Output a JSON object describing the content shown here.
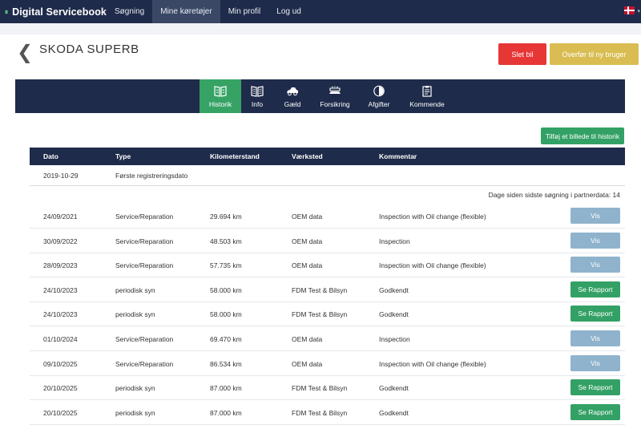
{
  "brand": {
    "name": "Digital Servicebook"
  },
  "nav": {
    "items": [
      {
        "label": "Søgning",
        "active": false
      },
      {
        "label": "Mine køretøjer",
        "active": true
      },
      {
        "label": "Min profil",
        "active": false
      },
      {
        "label": "Log ud",
        "active": false
      }
    ],
    "language_flag": "danish-flag-icon"
  },
  "vehicle": {
    "title": "SKODA SUPERB"
  },
  "actions": {
    "delete_label": "Slet bil",
    "transfer_label": "Overfør til ny bruger"
  },
  "tabs": [
    {
      "label": "Historik",
      "icon": "book-icon",
      "active": true
    },
    {
      "label": "Info",
      "icon": "open-book-icon",
      "active": false
    },
    {
      "label": "Gæld",
      "icon": "car-icon",
      "active": false
    },
    {
      "label": "Forsikring",
      "icon": "car-crash-icon",
      "active": false
    },
    {
      "label": "Afgifter",
      "icon": "coin-icon",
      "active": false
    },
    {
      "label": "Kommende",
      "icon": "clipboard-icon",
      "active": false
    }
  ],
  "history": {
    "add_photo_label": "Tilføj et billede til historik",
    "columns": [
      "Dato",
      "Type",
      "Kilometerstand",
      "Værksted",
      "Kommentar"
    ],
    "first_registration": {
      "date": "2019-10-29",
      "type": "Første registreringsdato"
    },
    "days_since_partner_search": "Dage siden sidste søgning i partnerdata: 14",
    "rows": [
      {
        "date": "24/09/2021",
        "type": "Service/Reparation",
        "km": "29.694 km",
        "workshop": "OEM data",
        "comment": "Inspection with Oil change (flexible)",
        "action": "Vis",
        "action_style": "vis"
      },
      {
        "date": "30/09/2022",
        "type": "Service/Reparation",
        "km": "48.503 km",
        "workshop": "OEM data",
        "comment": "Inspection",
        "action": "Vis",
        "action_style": "vis"
      },
      {
        "date": "28/09/2023",
        "type": "Service/Reparation",
        "km": "57.735 km",
        "workshop": "OEM data",
        "comment": "Inspection with Oil change (flexible)",
        "action": "Vis",
        "action_style": "vis"
      },
      {
        "date": "24/10/2023",
        "type": "periodisk syn",
        "km": "58.000 km",
        "workshop": "FDM Test & Bilsyn",
        "comment": "Godkendt",
        "action": "Se Rapport",
        "action_style": "rapport"
      },
      {
        "date": "24/10/2023",
        "type": "periodisk syn",
        "km": "58.000 km",
        "workshop": "FDM Test & Bilsyn",
        "comment": "Godkendt",
        "action": "Se Rapport",
        "action_style": "rapport"
      },
      {
        "date": "01/10/2024",
        "type": "Service/Reparation",
        "km": "69.470 km",
        "workshop": "OEM data",
        "comment": "Inspection",
        "action": "Vis",
        "action_style": "vis"
      },
      {
        "date": "09/10/2025",
        "type": "Service/Reparation",
        "km": "86.534 km",
        "workshop": "OEM data",
        "comment": "Inspection with Oil change (flexible)",
        "action": "Vis",
        "action_style": "vis"
      },
      {
        "date": "20/10/2025",
        "type": "periodisk syn",
        "km": "87.000 km",
        "workshop": "FDM Test & Bilsyn",
        "comment": "Godkendt",
        "action": "Se Rapport",
        "action_style": "rapport"
      },
      {
        "date": "20/10/2025",
        "type": "periodisk syn",
        "km": "87.000 km",
        "workshop": "FDM Test & Bilsyn",
        "comment": "Godkendt",
        "action": "Se Rapport",
        "action_style": "rapport"
      }
    ]
  },
  "colors": {
    "navy": "#1f2b4a",
    "green": "#33a165",
    "red": "#e63636",
    "gold": "#d9bd52",
    "vis_blue": "#8fb3cc"
  }
}
